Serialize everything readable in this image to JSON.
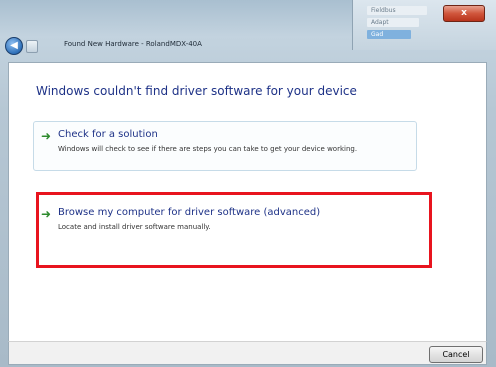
{
  "window": {
    "title": "Found New Hardware - RolandMDX-40A",
    "close_glyph": "x"
  },
  "background_window": {
    "items": [
      "Fieldbus",
      "Adapt",
      "Gad"
    ]
  },
  "dialog": {
    "main_instruction": "Windows couldn't find driver software for your device",
    "options": [
      {
        "heading": "Check for a solution",
        "description": "Windows will check to see if there are steps you can take to get your device working."
      },
      {
        "heading": "Browse my computer for driver software (advanced)",
        "description": "Locate and install driver software manually."
      }
    ],
    "cancel_label": "Cancel"
  },
  "icons": {
    "back": "back-arrow-icon",
    "option_arrow": "green-arrow-icon"
  },
  "colors": {
    "instruction": "#1e3287",
    "arrow": "#2d8a2d",
    "highlight": "#e8141e"
  }
}
